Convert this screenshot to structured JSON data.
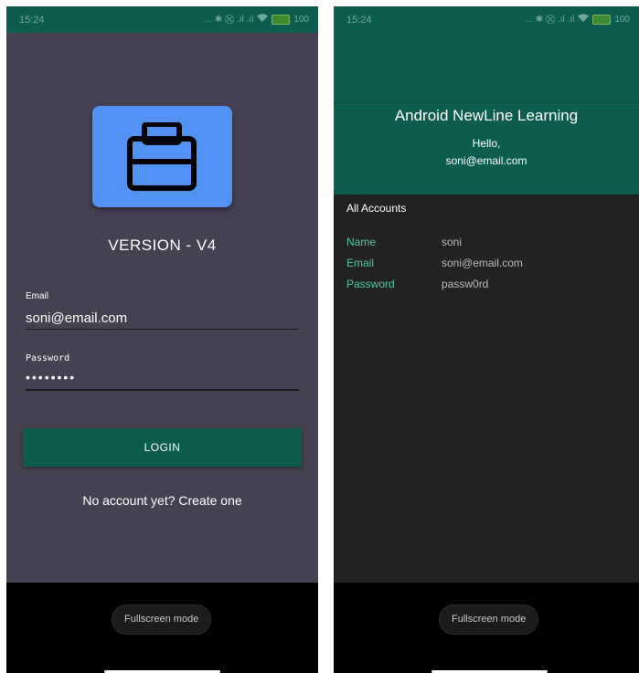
{
  "left_screen": {
    "status": {
      "time": "15:24",
      "icons_text": "... ✱ ⛒ .ıl .ıl",
      "battery_label": "100"
    },
    "version_text": "VERSION - V4",
    "email": {
      "label": "Email",
      "value": "soni@email.com"
    },
    "password": {
      "label": "Password",
      "value": "••••••••"
    },
    "login_button": "LOGIN",
    "create_account_link": "No account yet? Create one",
    "fullscreen_button": "Fullscreen mode"
  },
  "right_screen": {
    "status": {
      "time": "15:24",
      "icons_text": "... ✱ ⛒ .ıl .ıl",
      "battery_label": "100"
    },
    "title": "Android NewLine Learning",
    "greeting": "Hello,",
    "user_email": "soni@email.com",
    "section_title": "All Accounts",
    "accounts": [
      {
        "key": "Name",
        "value": "soni"
      },
      {
        "key": "Email",
        "value": "soni@email.com"
      },
      {
        "key": "Password",
        "value": "passw0rd"
      }
    ],
    "fullscreen_button": "Fullscreen mode"
  },
  "colors": {
    "primary_dark": "#0c5d4f",
    "login_bg": "#454052",
    "accent_teal": "#53c5a6",
    "logo_blue": "#5292f5",
    "accounts_bg": "#222222"
  },
  "icons": {
    "logo": "briefcase-icon",
    "wifi": "wifi-icon",
    "bluetooth": "bluetooth-icon",
    "battery": "battery-icon"
  }
}
